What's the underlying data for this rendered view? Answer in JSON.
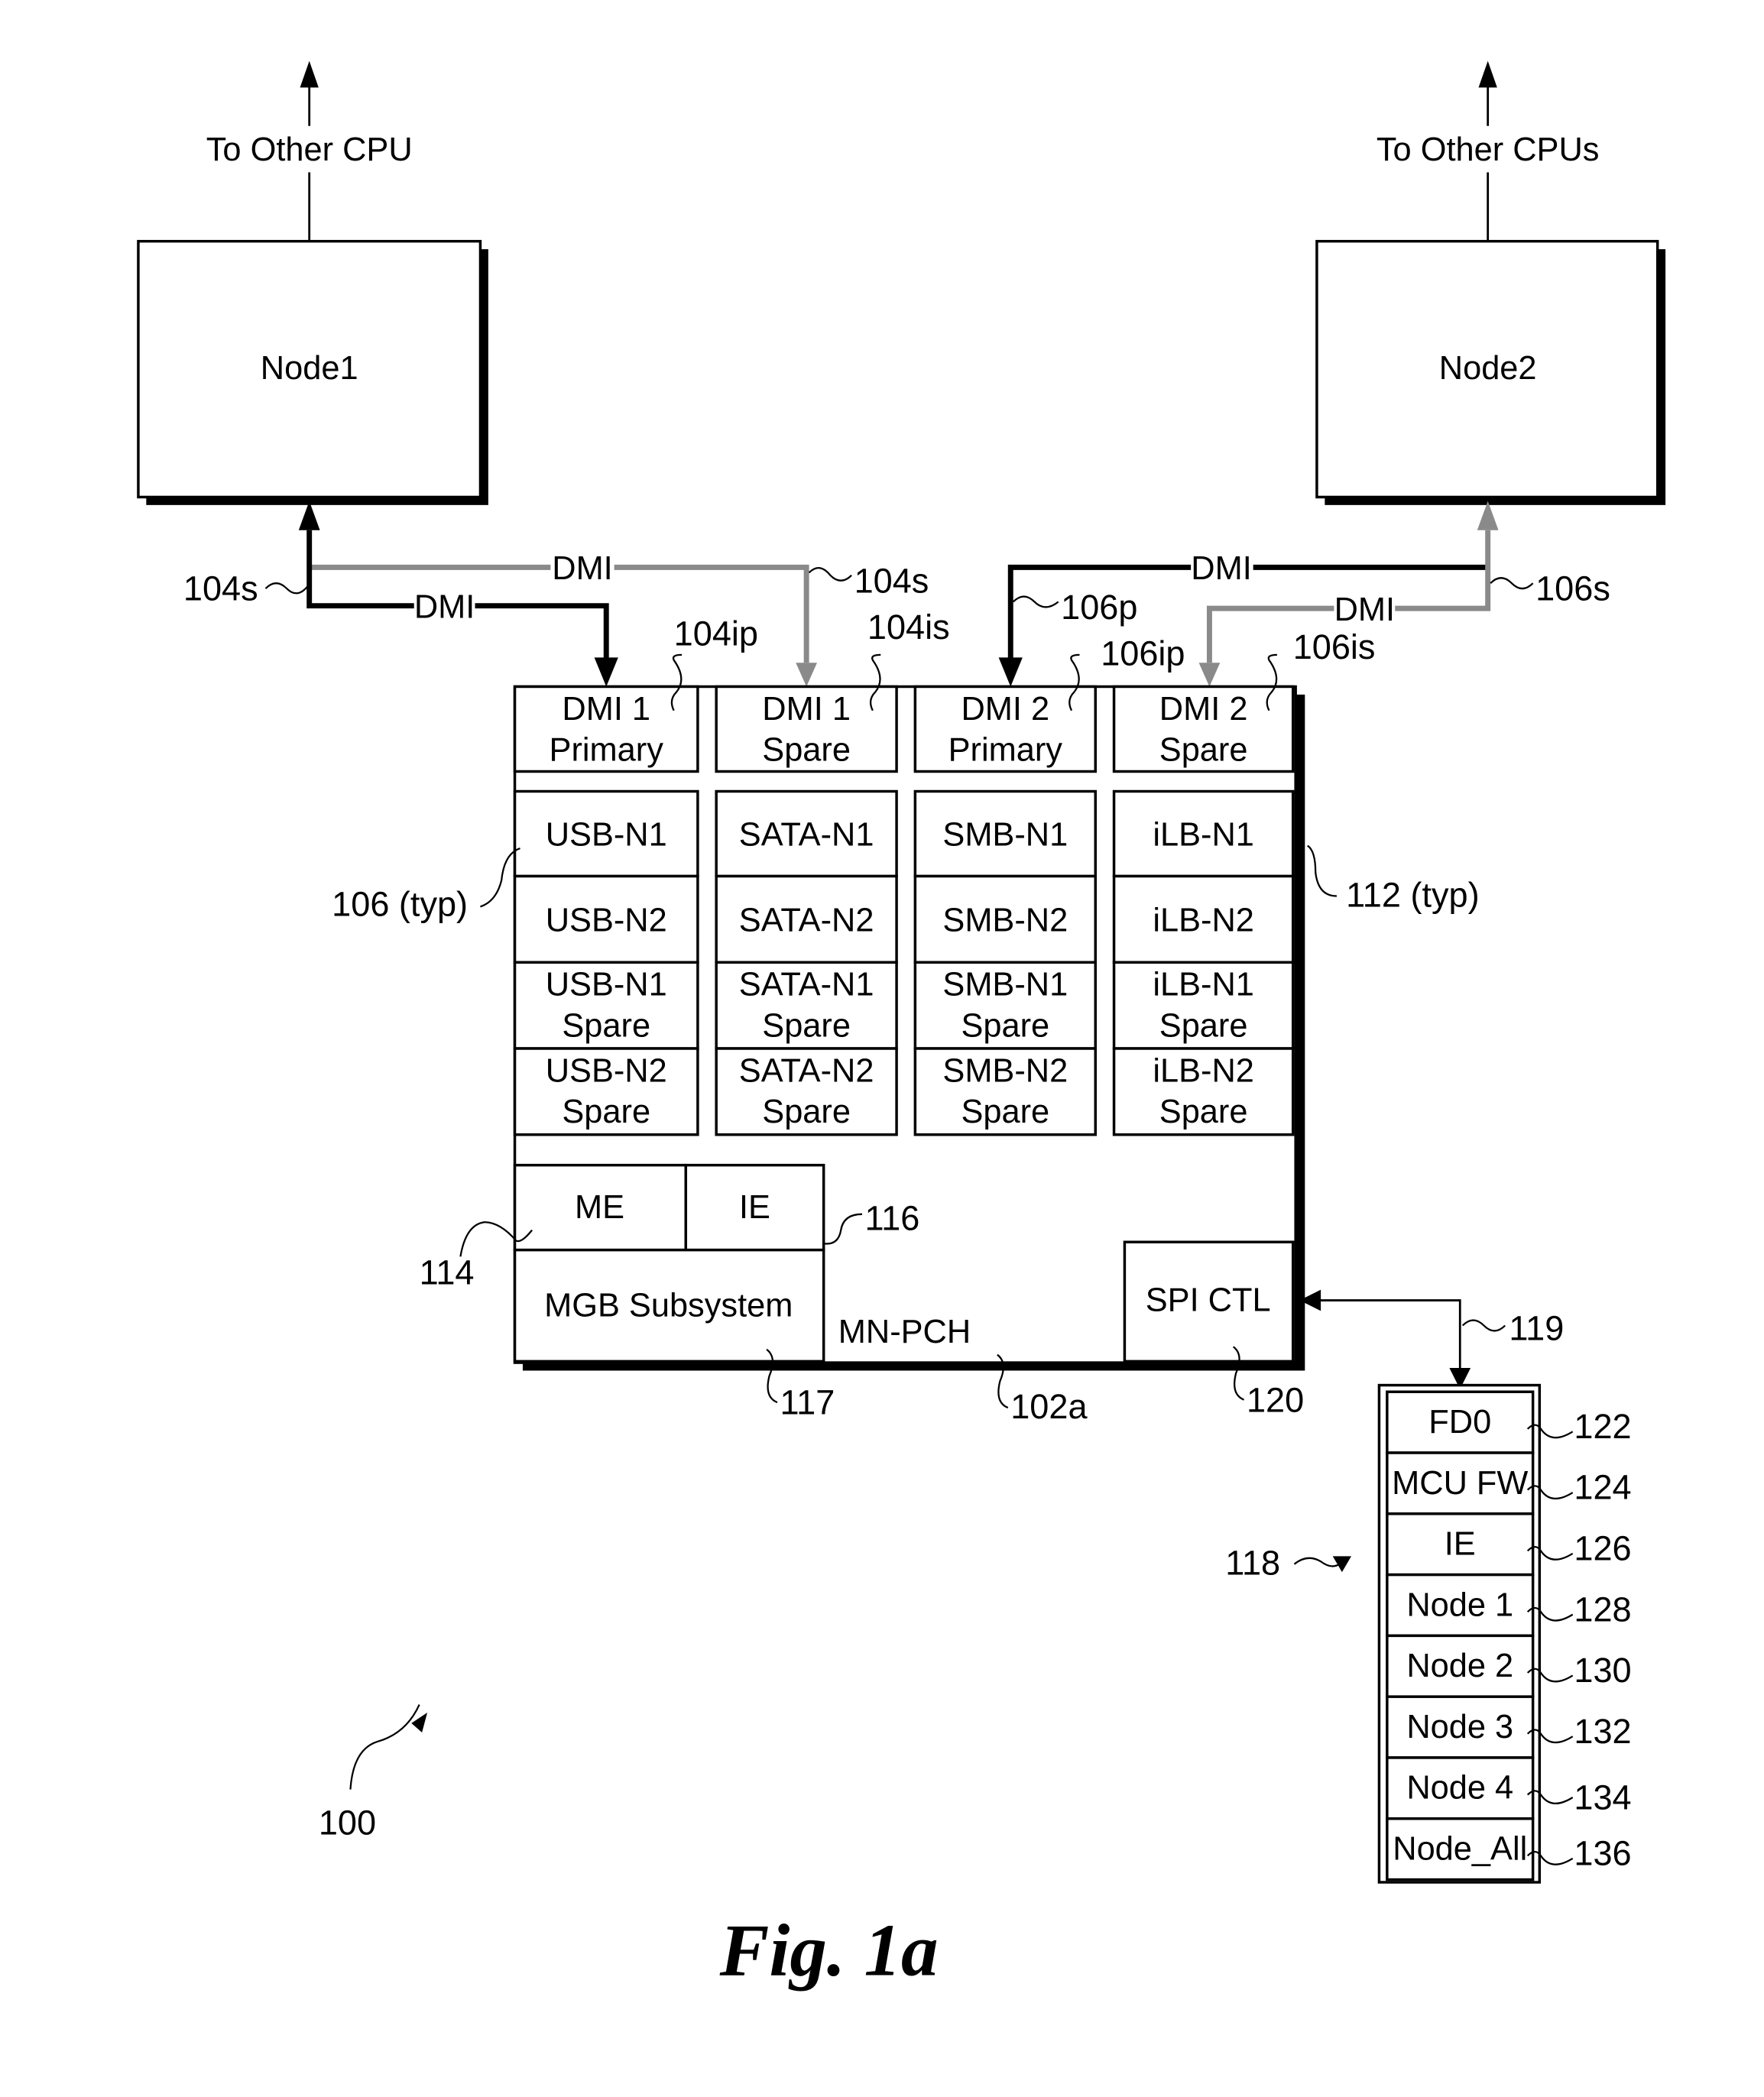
{
  "figure": {
    "caption": "Fig. 1a",
    "system_ref": "100"
  },
  "nodes": [
    {
      "id": "node1",
      "label": "Node1",
      "uplink_label": "To Other CPU"
    },
    {
      "id": "node2",
      "label": "Node2",
      "uplink_label": "To Other CPUs"
    }
  ],
  "links": {
    "dmi_label": "DMI",
    "node1_primary": {
      "label": "DMI",
      "style": "black"
    },
    "node1_spare": {
      "label": "DMI",
      "style": "gray"
    },
    "node2_primary": {
      "label": "DMI",
      "style": "black"
    },
    "node2_spare": {
      "label": "DMI",
      "style": "gray"
    },
    "colors": {
      "primary": "#000000",
      "spare": "#8a8a8a"
    }
  },
  "pch": {
    "label": "MN-PCH",
    "ref": "102a",
    "dmi_ports": [
      {
        "line1": "DMI 1",
        "line2": "Primary",
        "ref": "104ip"
      },
      {
        "line1": "DMI 1",
        "line2": "Spare",
        "ref": "104is"
      },
      {
        "line1": "DMI 2",
        "line2": "Primary",
        "ref": "106ip"
      },
      {
        "line1": "DMI 2",
        "line2": "Spare",
        "ref": "106is"
      }
    ],
    "io_grid": [
      [
        {
          "line1": "USB-N1",
          "line2": ""
        },
        {
          "line1": "SATA-N1",
          "line2": ""
        },
        {
          "line1": "SMB-N1",
          "line2": ""
        },
        {
          "line1": "iLB-N1",
          "line2": ""
        }
      ],
      [
        {
          "line1": "USB-N2",
          "line2": ""
        },
        {
          "line1": "SATA-N2",
          "line2": ""
        },
        {
          "line1": "SMB-N2",
          "line2": ""
        },
        {
          "line1": "iLB-N2",
          "line2": ""
        }
      ],
      [
        {
          "line1": "USB-N1",
          "line2": "Spare"
        },
        {
          "line1": "SATA-N1",
          "line2": "Spare"
        },
        {
          "line1": "SMB-N1",
          "line2": "Spare"
        },
        {
          "line1": "iLB-N1",
          "line2": "Spare"
        }
      ],
      [
        {
          "line1": "USB-N2",
          "line2": "Spare"
        },
        {
          "line1": "SATA-N2",
          "line2": "Spare"
        },
        {
          "line1": "SMB-N2",
          "line2": "Spare"
        },
        {
          "line1": "iLB-N2",
          "line2": "Spare"
        }
      ]
    ],
    "me_label": "ME",
    "ie_label": "IE",
    "mgb_label": "MGB Subsystem",
    "spi_label": "SPI CTL"
  },
  "flash": {
    "ref": "118",
    "link_ref": "119",
    "regions": [
      {
        "label": "FD0",
        "ref": "122"
      },
      {
        "label": "MCU FW",
        "ref": "124"
      },
      {
        "label": "IE",
        "ref": "126"
      },
      {
        "label": "Node 1",
        "ref": "128"
      },
      {
        "label": "Node 2",
        "ref": "130"
      },
      {
        "label": "Node 3",
        "ref": "132"
      },
      {
        "label": "Node 4",
        "ref": "134"
      },
      {
        "label": "Node_All",
        "ref": "136"
      }
    ]
  },
  "refs": {
    "r104s": "104s",
    "r104s_right": "104s",
    "r106p": "106p",
    "r106s": "106s",
    "r106typ": "106 (typ)",
    "r112typ": "112 (typ)",
    "r114": "114",
    "r116": "116",
    "r117": "117",
    "r120": "120"
  }
}
